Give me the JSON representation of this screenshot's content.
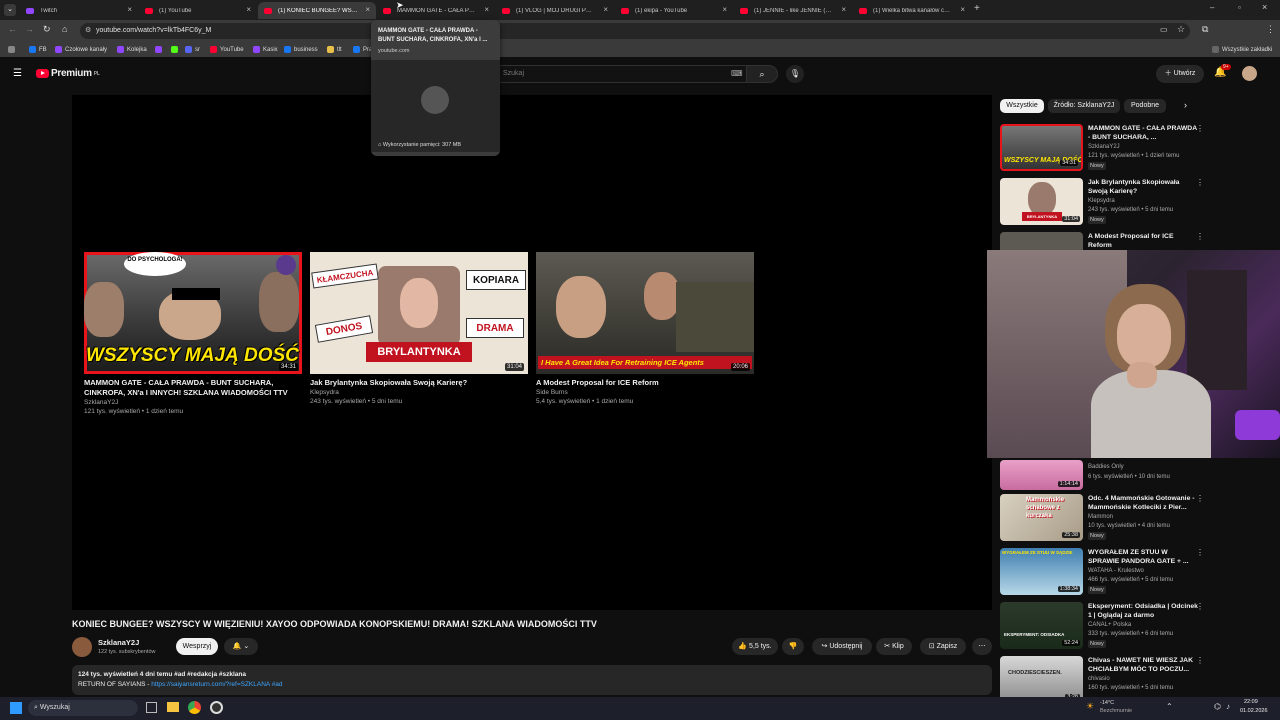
{
  "browser": {
    "tabs": [
      {
        "title": "Twitch",
        "icon": "twitch-icon",
        "active": false
      },
      {
        "title": "(1) YouTube",
        "icon": "youtube-icon",
        "active": false
      },
      {
        "title": "(1) KONIEC BUNGEE? WSZYSCY",
        "icon": "youtube-icon",
        "active": true
      },
      {
        "title": "MAMMON GATE - CAŁA PRAWD",
        "icon": "youtube-icon",
        "active": false
      },
      {
        "title": "(1) VLOG | MÓJ DRUGI PORÓD",
        "icon": "youtube-icon",
        "active": false
      },
      {
        "title": "(1) ekipa - YouTube",
        "icon": "youtube-icon",
        "active": false
      },
      {
        "title": "(1) JENNIE - like JENNIE (Offici",
        "icon": "youtube-icon",
        "active": false
      },
      {
        "title": "(1) Wielka bitwa kanałów come",
        "icon": "youtube-icon",
        "active": false
      }
    ],
    "url": "youtube.com/watch?v=lkTb4FC6y_M",
    "bookmarks": [
      "FB",
      "Czołowe kanały",
      "Kolejka",
      "",
      "",
      "",
      "sr",
      "YouTube",
      "Kasix",
      "business",
      "tlt",
      "Pra"
    ],
    "bookmarks_right": "Wszystkie zakładki",
    "tooltip": {
      "title": "MAMMON GATE - CAŁA PRAWDA - BUNT SUCHARA, CINKROFA, XN'a I ...",
      "domain": "youtube.com",
      "memory": "Wykorzystanie pamięci: 307 MB"
    }
  },
  "youtube": {
    "logo": "Premium",
    "logo_sup": "PL",
    "search_placeholder": "Szukaj",
    "create_label": "Utwórz",
    "notif_count": "9+",
    "endcards": [
      {
        "title": "MAMMON GATE - CAŁA PRAWDA - BUNT SUCHARA, CINKROFA, XN'a I INNYCH! SZKLANA WIADOMOŚCI TTV",
        "channel": "SzklanaY2J",
        "meta": "121 tys. wyświetleń • 1 dzień temu",
        "duration": "34:31",
        "thumb_text": "WSZYSCY MAJĄ DOŚĆ",
        "bubble": "DO PSYCHOLOGA!"
      },
      {
        "title": "Jak Brylantynka Skopiowała Swoją Karierę?",
        "channel": "Klepsydra",
        "meta": "243 tys. wyświetleń • 5 dni temu",
        "duration": "31:04",
        "thumb_labels": [
          "KŁAMCZUCHA",
          "KOPIARA",
          "DONOS",
          "DRAMA",
          "BRYLANTYNKA"
        ]
      },
      {
        "title": "A Modest Proposal for ICE Reform",
        "channel": "Side Burns",
        "meta": "5,4 tys. wyświetleń • 1 dzień temu",
        "duration": "20:06",
        "thumb_text": "I Have A Great Idea For Retraining ICE Agents"
      }
    ],
    "video": {
      "title": "KONIEC BUNGEE? WSZYSCY W WIĘZIENIU! XAYOO ODPOWIADA KONOPSKIEMU! DRAMA! SZKLANA WIADOMOŚCI TTV",
      "channel": "SzklanaY2J",
      "subs": "122 tys. subskrybentów",
      "support_label": "Wesprzyj",
      "likes": "5,5 tys.",
      "share_label": "Udostępnij",
      "clip_label": "Klip",
      "save_label": "Zapisz",
      "desc_meta": "124 tys. wyświetleń  4 dni temu  #ad #redakcja #szklana",
      "desc_line2": "RETURN OF SAYIANS - ",
      "desc_link": "https://saiyansreturn.com/?ref=SZKLANA #ad"
    },
    "chips": [
      "Wszystkie",
      "Źródło: SzklanaY2J",
      "Podobne"
    ],
    "related": [
      {
        "title": "MAMMON GATE - CAŁA PRAWDA - BUNT SUCHARA, ...",
        "channel": "SzklanaY2J",
        "meta": "121 tys. wyświetleń • 1 dzień temu",
        "badge": "Nowy",
        "duration": "34:31"
      },
      {
        "title": "Jak Brylantynka Skopiowała Swoją Karierę?",
        "channel": "Klepsydra",
        "meta": "243 tys. wyświetleń • 5 dni temu",
        "badge": "Nowy",
        "duration": "31:04"
      },
      {
        "title": "A Modest Proposal for ICE Reform",
        "channel": "",
        "meta": "",
        "badge": "",
        "duration": ""
      },
      {
        "title": "",
        "channel": "Baddies Only",
        "meta": "6 tys. wyświetleń • 10 dni temu",
        "badge": "",
        "duration": "1:14:14"
      },
      {
        "title": "Odc. 4 Mammońskie Gotowanie - Mammońskie Kotleciki z Pier...",
        "channel": "Mammon",
        "meta": "10 tys. wyświetleń • 4 dni temu",
        "badge": "Nowy",
        "duration": "25:38"
      },
      {
        "title": "WYGRAŁEM ZE STUU W SPRAWIE PANDORA GATE + ...",
        "channel": "WATAHA - Krulestwo",
        "meta": "466 tys. wyświetleń • 5 dni temu",
        "badge": "Nowy",
        "duration": "1:38:34"
      },
      {
        "title": "Eksperyment: Odsiadka | Odcinek 1 | Oglądaj za darmo",
        "channel": "CANAL+ Polska",
        "meta": "333 tys. wyświetleń • 6 dni temu",
        "badge": "Nowy",
        "duration": "52:24"
      },
      {
        "title": "Chivas - NAWET NIE WIESZ JAK CHCIAŁBYM MÓC TO POCZU...",
        "channel": "chivasio",
        "meta": "160 tys. wyświetleń • 5 dni temu",
        "badge": "",
        "duration": "3:28"
      }
    ],
    "related_thumb_texts": {
      "mammon": "Mammońskie schabowe z kurczaka",
      "wataha": "WYGRAŁEM ZE STUU W SĄDZIE",
      "eksperyment": "EKSPERYMENT: ODSIADKA",
      "chivas": "CHODZIESCIESZEN."
    }
  },
  "taskbar": {
    "search_placeholder": "Wyszukaj",
    "weather_temp": "-14°C",
    "weather_desc": "Bezchmurnie",
    "time": "22:09",
    "date": "01.02.2026"
  },
  "colors": {
    "yt_red": "#ff0033",
    "bg": "#0f0f0f",
    "chip": "#272727",
    "taskbar": "#1d1f2a"
  }
}
